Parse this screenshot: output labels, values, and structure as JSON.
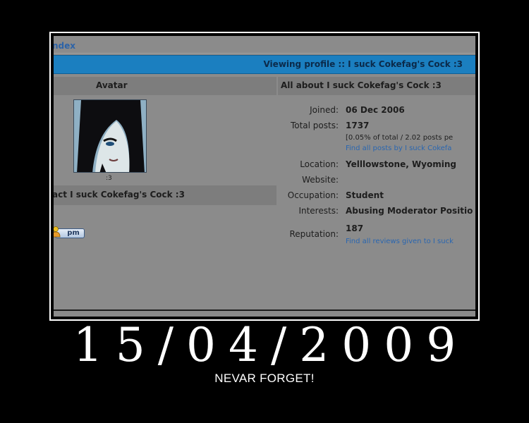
{
  "breadcrumb": "ndex",
  "title_bar": "Viewing profile :: I suck Cokefag's Cock :3",
  "left_header": "Avatar",
  "right_header": "All about I suck Cokefag's Cock :3",
  "avatar_caption": ":3",
  "contact_title": "act I suck Cokefag's Cock :3",
  "pm_label": "pm",
  "profile": {
    "joined_label": "Joined:",
    "joined_value": "06 Dec 2006",
    "posts_label": "Total posts:",
    "posts_value": "1737",
    "posts_stats": "[0.05% of total / 2.02 posts pe",
    "posts_link": "Find all posts by I suck Cokefa",
    "location_label": "Location:",
    "location_value": "Yelllowstone, Wyoming",
    "website_label": "Website:",
    "occupation_label": "Occupation:",
    "occupation_value": "Student",
    "interests_label": "Interests:",
    "interests_value": "Abusing Moderator Positio",
    "reputation_label": "Reputation:",
    "reputation_value": "187",
    "reputation_link": "Find all reviews given to I suck"
  },
  "date_caption": "15/04/2009",
  "motto": "NEVAR FORGET!",
  "colors": {
    "title_bar": "#1b7fc0",
    "link": "#2a66b0",
    "panel": "#8b8b8b"
  }
}
